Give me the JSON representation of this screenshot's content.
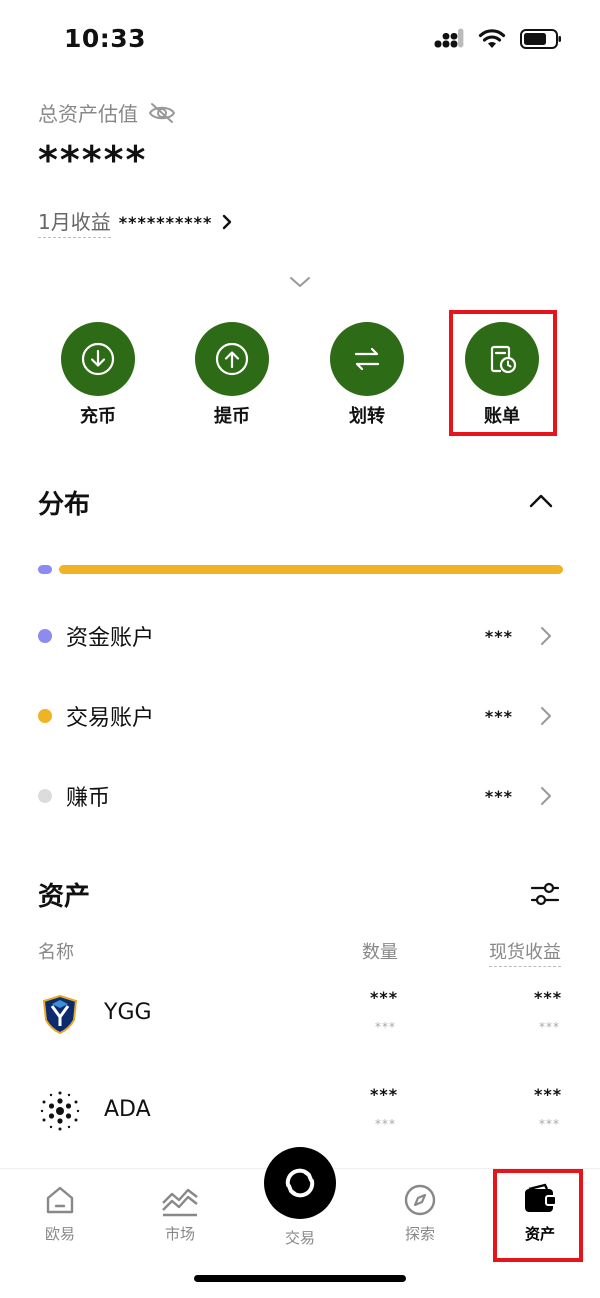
{
  "status_bar": {
    "time": "10:33"
  },
  "summary": {
    "label": "总资产估值",
    "value": "*****",
    "pnl_label": "1月收益",
    "pnl_value": "**********"
  },
  "actions": [
    {
      "label": "充币",
      "icon": "deposit-icon"
    },
    {
      "label": "提币",
      "icon": "withdraw-icon"
    },
    {
      "label": "划转",
      "icon": "transfer-icon"
    },
    {
      "label": "账单",
      "icon": "bill-icon"
    }
  ],
  "distribution": {
    "title": "分布",
    "bar_segments": [
      {
        "color": "#8b8bf0",
        "share": 0.03
      },
      {
        "color": "#f0b323",
        "share": 0.97
      }
    ],
    "accounts": [
      {
        "name": "资金账户",
        "value": "***",
        "color": "#8b8bf0"
      },
      {
        "name": "交易账户",
        "value": "***",
        "color": "#f0b323"
      },
      {
        "name": "赚币",
        "value": "***",
        "color": "#dcdcdc"
      }
    ]
  },
  "assets": {
    "title": "资产",
    "columns": {
      "name": "名称",
      "quantity": "数量",
      "spot_pnl": "现货收益"
    },
    "rows": [
      {
        "symbol": "YGG",
        "quantity": "***",
        "quantity_sub": "***",
        "pnl": "***",
        "pnl_sub": "***",
        "icon": "ygg-logo"
      },
      {
        "symbol": "ADA",
        "quantity": "***",
        "quantity_sub": "***",
        "pnl": "***",
        "pnl_sub": "***",
        "icon": "ada-logo"
      }
    ]
  },
  "tab_bar": {
    "tabs": [
      {
        "label": "欧易",
        "icon": "home-icon"
      },
      {
        "label": "市场",
        "icon": "market-chart-icon"
      },
      {
        "label": "交易",
        "icon": "swap-icon"
      },
      {
        "label": "探索",
        "icon": "compass-icon"
      },
      {
        "label": "资产",
        "icon": "wallet-icon",
        "active": true
      }
    ]
  },
  "colors": {
    "accent_green": "#2e6b17",
    "highlight_red": "#e8141c"
  }
}
